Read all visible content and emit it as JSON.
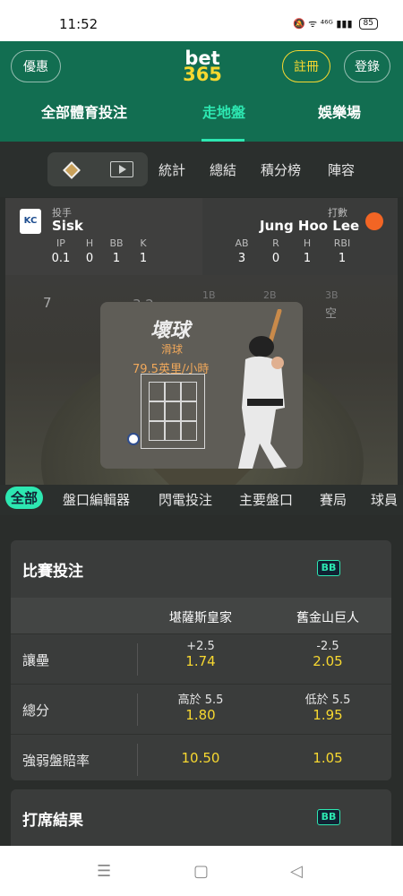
{
  "status": {
    "time": "11:52",
    "icons": "🔕 ᯤ ⁴⁶ᴳ ▮▮▮",
    "battery": "85"
  },
  "header": {
    "promo": "優惠",
    "logo_top": "bet",
    "logo_bottom": "365",
    "register": "註冊",
    "login": "登錄",
    "tabs": [
      "全部體育投注",
      "走地盤",
      "娛樂場"
    ]
  },
  "match_tabs": [
    "統計",
    "總結",
    "積分榜",
    "陣容"
  ],
  "scoreboard": {
    "pitcher_role": "投手",
    "pitcher": "Sisk",
    "pitcher_team_logo": "KC",
    "pitcher_stats": {
      "headers": [
        "IP",
        "H",
        "BB",
        "K"
      ],
      "values": [
        "0.1",
        "0",
        "1",
        "1"
      ]
    },
    "batter_role": "打數",
    "batter": "Jung Hoo Lee",
    "batter_stats": {
      "headers": [
        "AB",
        "R",
        "H",
        "RBI"
      ],
      "values": [
        "3",
        "0",
        "1",
        "1"
      ]
    }
  },
  "field": {
    "inning": "7",
    "count": "3 2",
    "bases": [
      "1B",
      "2B",
      "3B"
    ],
    "base3_status": "空",
    "pitch_result": "壞球",
    "pitch_type": "滑球",
    "pitch_speed": "79.5英里/小時"
  },
  "filters": [
    "全部",
    "盤口編輯器",
    "閃電投注",
    "主要盤口",
    "賽局",
    "球員"
  ],
  "game_bets": {
    "title": "比賽投注",
    "badge": "BB",
    "teams": [
      "堪薩斯皇家",
      "舊金山巨人"
    ],
    "rows": [
      {
        "label": "讓壘",
        "home_line": "+2.5",
        "home_odd": "1.74",
        "away_line": "-2.5",
        "away_odd": "2.05"
      },
      {
        "label": "總分",
        "home_line": "高於 5.5",
        "home_odd": "1.80",
        "away_line": "低於 5.5",
        "away_odd": "1.95"
      },
      {
        "label": "強弱盤賠率",
        "home_line": "",
        "home_odd": "10.50",
        "away_line": "",
        "away_odd": "1.05"
      }
    ]
  },
  "at_bat": {
    "title": "打席結果",
    "badge": "BB"
  },
  "bottom_nav": {
    "menu": "☰",
    "home": "▢",
    "back": "◁"
  }
}
